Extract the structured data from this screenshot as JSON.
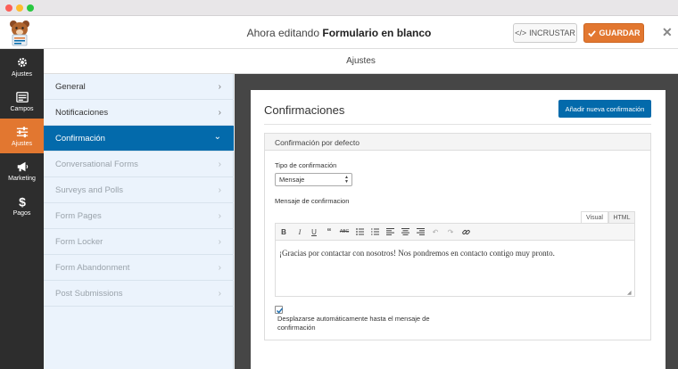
{
  "header": {
    "editing_prefix": "Ahora editando",
    "form_name": "Formulario en blanco",
    "embed_label": "INCRUSTAR",
    "save_label": "GUARDAR"
  },
  "iconbar": [
    {
      "label": "Ajustes",
      "icon": "gear-icon"
    },
    {
      "label": "Campos",
      "icon": "fields-icon"
    },
    {
      "label": "Ajustes",
      "icon": "sliders-icon",
      "active": true
    },
    {
      "label": "Marketing",
      "icon": "megaphone-icon"
    },
    {
      "label": "Pagos",
      "icon": "dollar-icon"
    }
  ],
  "section_title": "Ajustes",
  "sidebar": {
    "items": [
      {
        "label": "General"
      },
      {
        "label": "Notificaciones"
      },
      {
        "label": "Confirmación"
      },
      {
        "label": "Conversational Forms"
      },
      {
        "label": "Surveys and Polls"
      },
      {
        "label": "Form Pages"
      },
      {
        "label": "Form Locker"
      },
      {
        "label": "Form Abandonment"
      },
      {
        "label": "Post Submissions"
      }
    ]
  },
  "panel": {
    "title": "Confirmaciones",
    "add_button": "Añadir nueva confirmación",
    "box_title": "Confirmación por defecto",
    "type_label": "Tipo de confirmación",
    "type_value": "Mensaje",
    "message_label": "Mensaje de confirmacion",
    "tab_visual": "Visual",
    "tab_html": "HTML",
    "message_text": "¡Gracias por contactar con nosotros! Nos pondremos en contacto contigo muy pronto.",
    "scroll_label": "Desplazarse automáticamente hasta el mensaje de confirmación"
  },
  "colors": {
    "accent_orange": "#e27730",
    "accent_blue": "#036aab",
    "sidebar_bg": "#ebf3fc",
    "iconbar_bg": "#2d2d2d"
  }
}
